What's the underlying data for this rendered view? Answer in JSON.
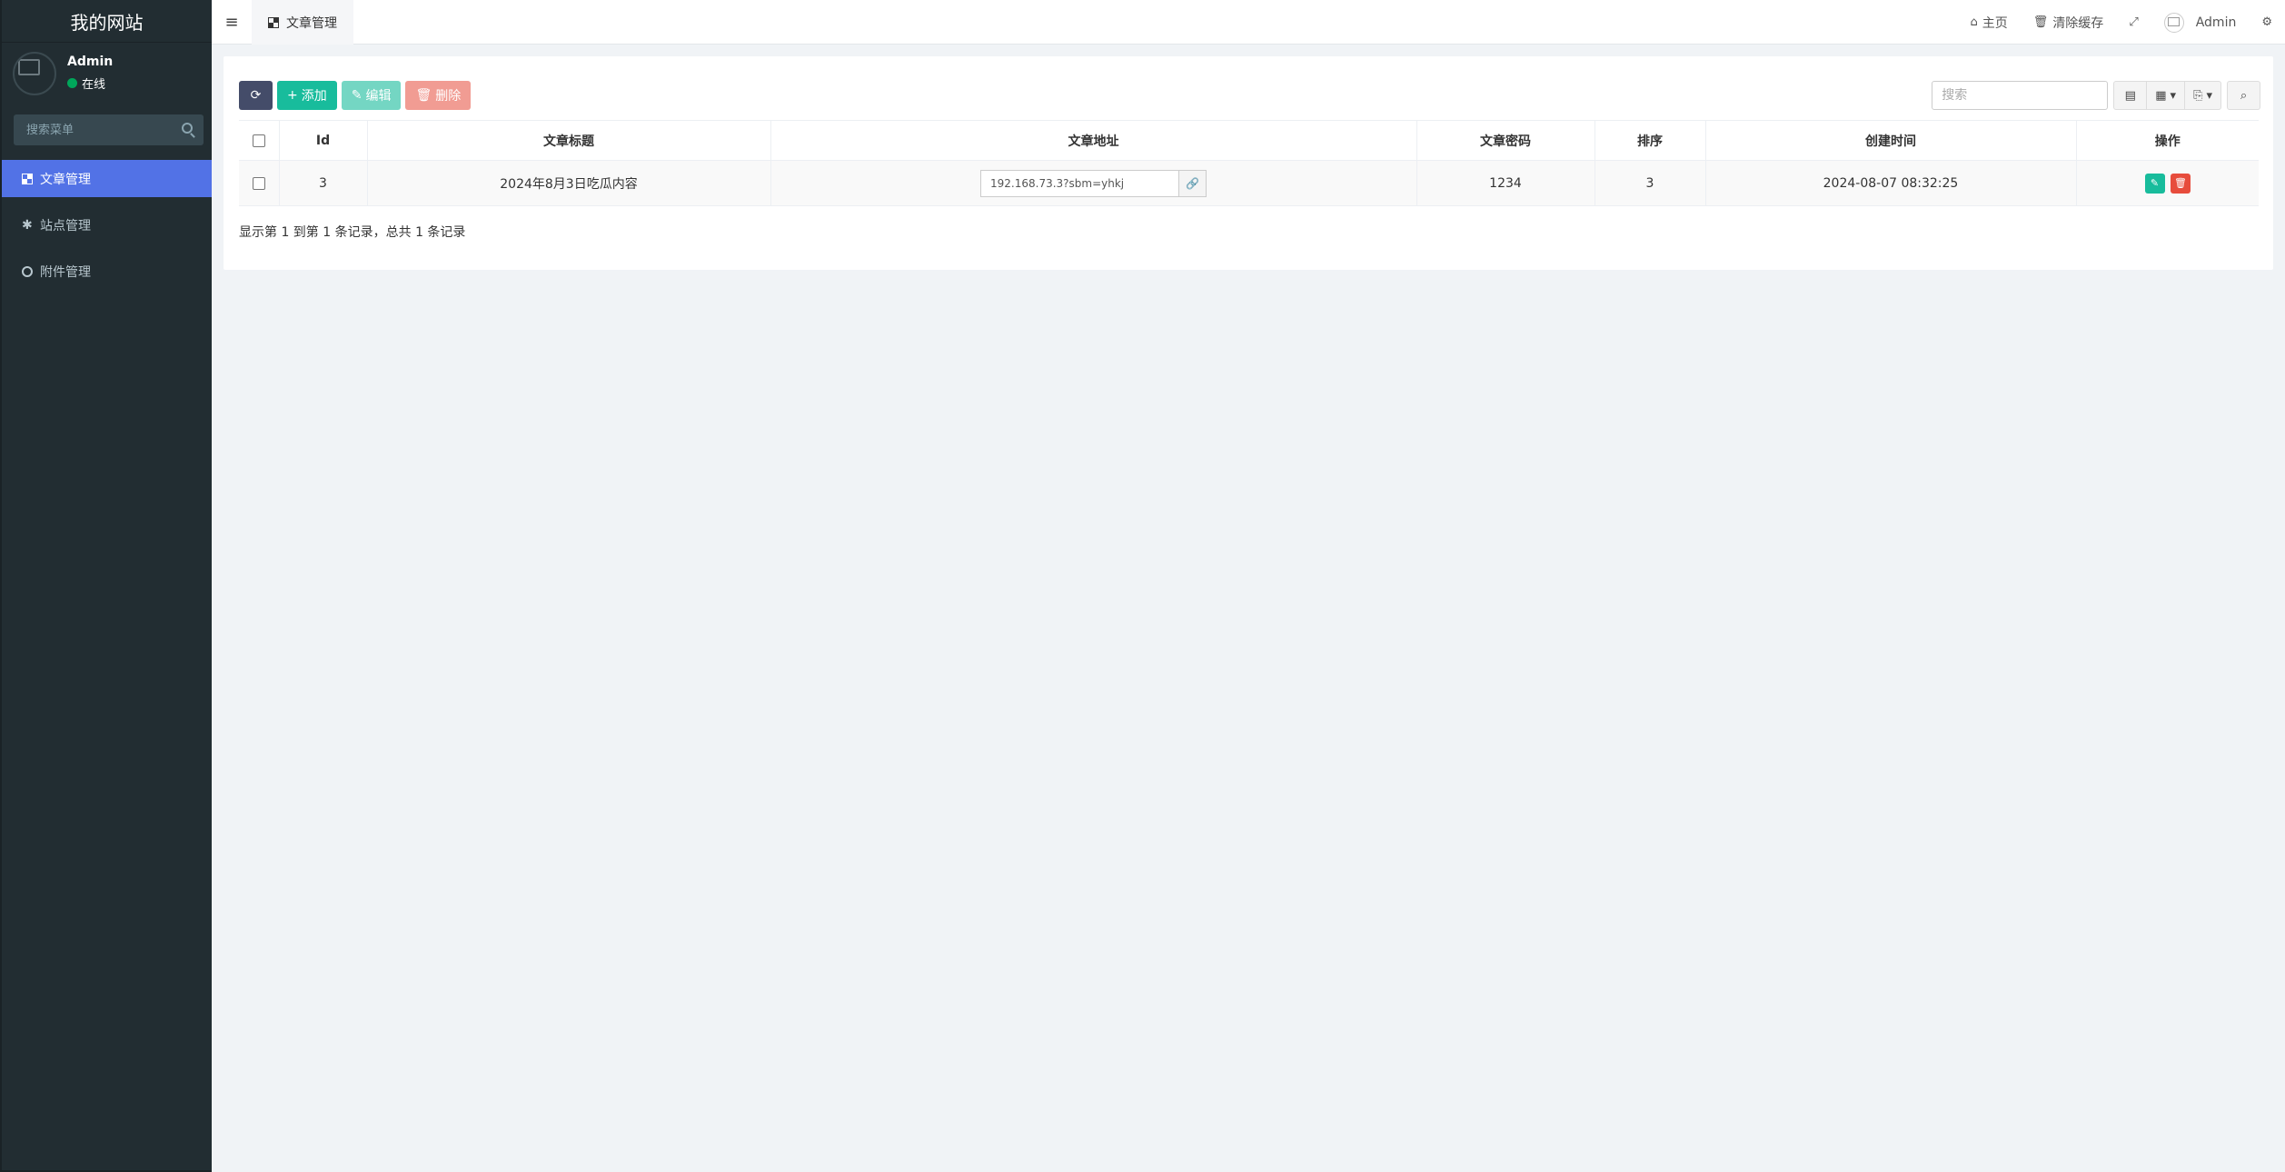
{
  "sidebar": {
    "brand": "我的网站",
    "user": {
      "name": "Admin",
      "status": "在线"
    },
    "search_placeholder": "搜索菜单",
    "items": [
      {
        "label": "文章管理",
        "icon": "dashboard-icon",
        "active": true
      },
      {
        "label": "站点管理",
        "icon": "gear-icon",
        "active": false
      },
      {
        "label": "附件管理",
        "icon": "circle-icon",
        "active": false
      }
    ]
  },
  "header": {
    "tab_label": "文章管理",
    "home": "主页",
    "clear_cache": "清除缓存",
    "user": "Admin"
  },
  "toolbar": {
    "add_label": "添加",
    "edit_label": "编辑",
    "delete_label": "删除",
    "search_placeholder": "搜索"
  },
  "table": {
    "headers": [
      "Id",
      "文章标题",
      "文章地址",
      "文章密码",
      "排序",
      "创建时间",
      "操作"
    ],
    "rows": [
      {
        "id": "3",
        "title": "2024年8月3日吃瓜内容",
        "url": "192.168.73.3?sbm=yhkj",
        "password": "1234",
        "sort": "3",
        "created": "2024-08-07 08:32:25"
      }
    ]
  },
  "pagination": {
    "summary": "显示第 1 到第 1 条记录，总共 1 条记录"
  },
  "colors": {
    "sidebar_bg": "#222d32",
    "active_item": "#5272e6",
    "success": "#18bc9c",
    "danger": "#e74c3c",
    "refresh": "#444c69"
  }
}
